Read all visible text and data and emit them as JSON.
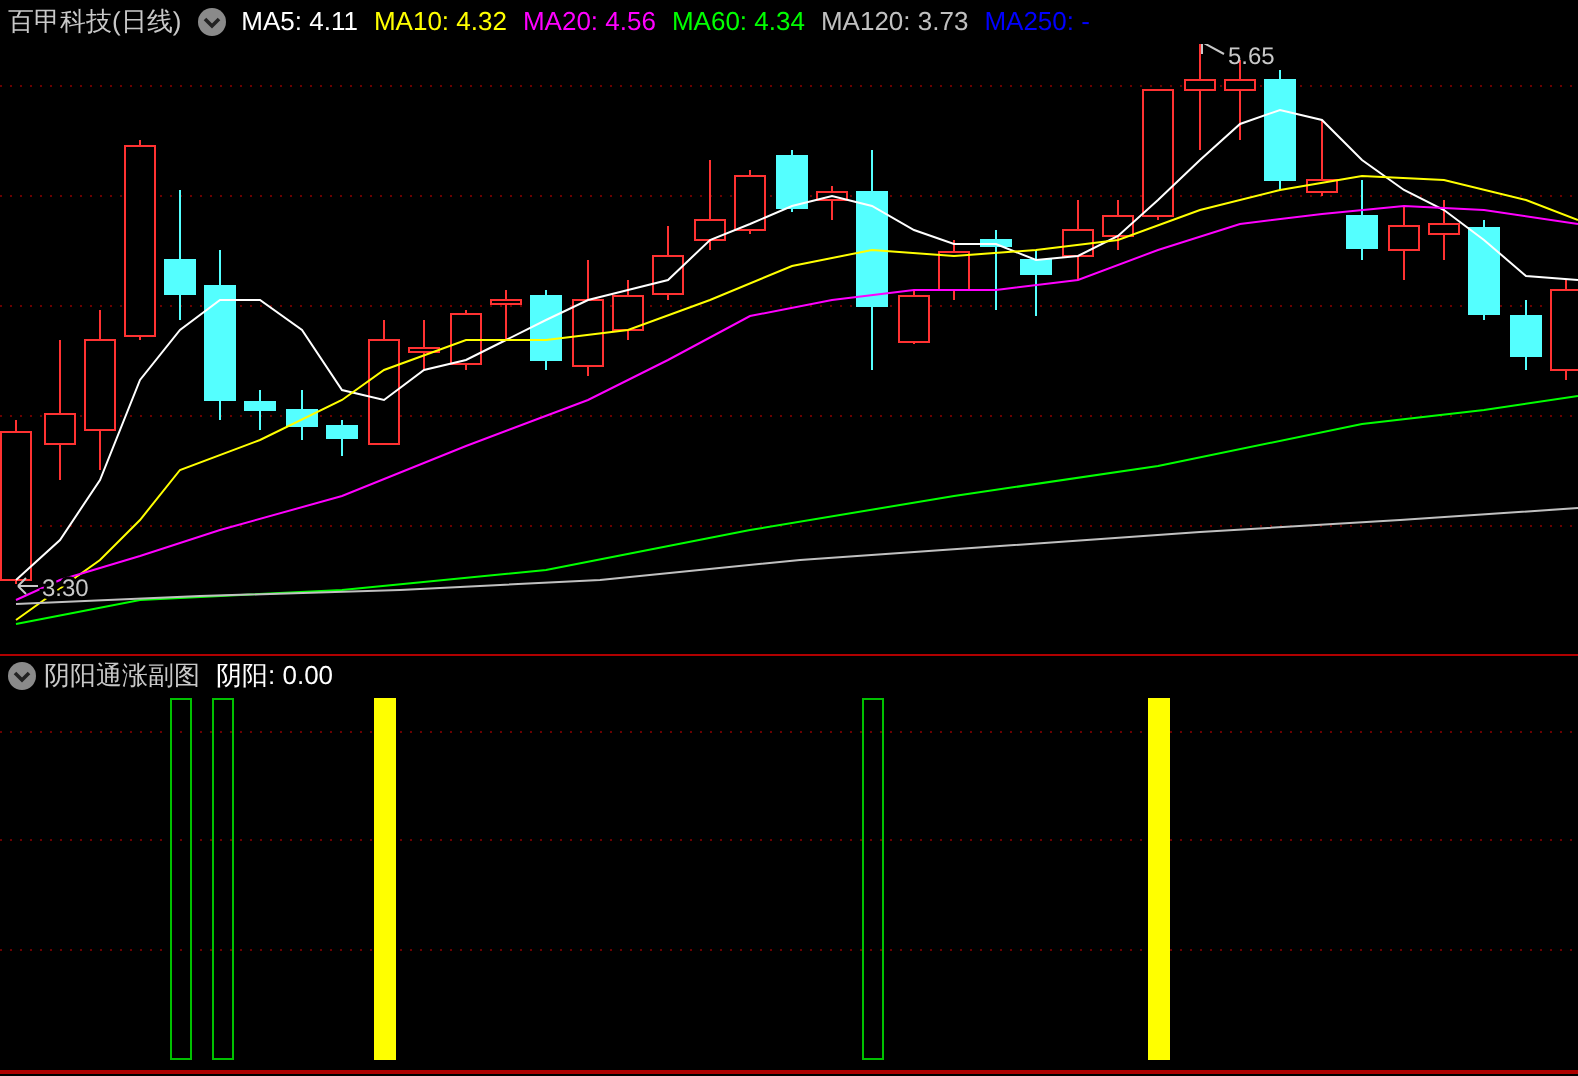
{
  "header": {
    "title": "百甲科技(日线)",
    "indicators": [
      {
        "label": "MA5: 4.11",
        "color": "#ffffff"
      },
      {
        "label": "MA10: 4.32",
        "color": "#ffff00"
      },
      {
        "label": "MA20: 4.56",
        "color": "#ff00ff"
      },
      {
        "label": "MA60: 4.34",
        "color": "#00ff00"
      },
      {
        "label": "MA120: 3.73",
        "color": "#c0c0c0"
      },
      {
        "label": "MA250: -",
        "color": "#0000ff"
      }
    ]
  },
  "price_chart": {
    "high_label": "5.65",
    "low_label": "3.30"
  },
  "sub_panel": {
    "title": "阴阳通涨副图",
    "readout": "阴阳: 0.00"
  }
}
